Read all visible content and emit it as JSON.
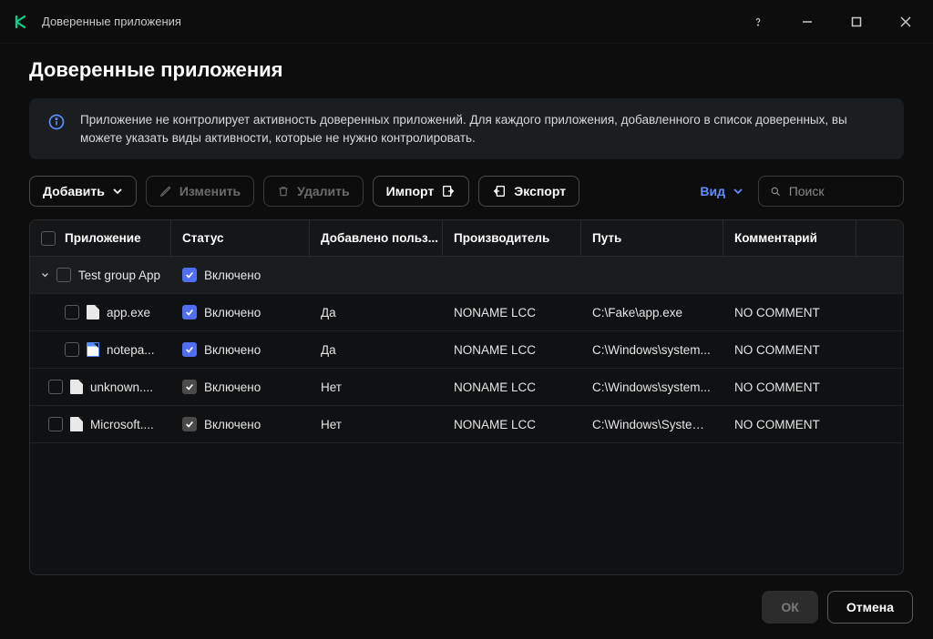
{
  "window": {
    "title": "Доверенные приложения"
  },
  "page": {
    "heading": "Доверенные приложения",
    "info": "Приложение не контролирует активность доверенных приложений. Для каждого приложения, добавленного в список доверенных, вы можете указать виды активности, которые не нужно контролировать."
  },
  "toolbar": {
    "add": "Добавить",
    "edit": "Изменить",
    "delete": "Удалить",
    "import": "Импорт",
    "export": "Экспорт",
    "view": "Вид"
  },
  "search": {
    "placeholder": "Поиск"
  },
  "columns": {
    "app": "Приложение",
    "status": "Статус",
    "added": "Добавлено польз...",
    "vendor": "Производитель",
    "path": "Путь",
    "comment": "Комментарий"
  },
  "group": {
    "name": "Test group App",
    "status": "Включено"
  },
  "rows": [
    {
      "name": "app.exe",
      "icon": "file",
      "status": "Включено",
      "status_style": "blue",
      "added": "Да",
      "vendor": "NONAME LCC",
      "path": "C:\\Fake\\app.exe",
      "comment": "NO COMMENT",
      "indent": 2
    },
    {
      "name": "notepa...",
      "icon": "notepad",
      "status": "Включено",
      "status_style": "blue",
      "added": "Да",
      "vendor": "NONAME LCC",
      "path": "C:\\Windows\\system...",
      "comment": "NO COMMENT",
      "indent": 2
    },
    {
      "name": "unknown....",
      "icon": "file",
      "status": "Включено",
      "status_style": "grey",
      "added": "Нет",
      "vendor": "NONAME LCC",
      "path": "C:\\Windows\\system...",
      "comment": "NO COMMENT",
      "indent": 1
    },
    {
      "name": "Microsoft....",
      "icon": "file",
      "status": "Включено",
      "status_style": "grey",
      "added": "Нет",
      "vendor": "NONAME LCC",
      "path": "C:\\Windows\\System...",
      "comment": "NO COMMENT",
      "indent": 1
    }
  ],
  "footer": {
    "ok": "ОК",
    "cancel": "Отмена"
  }
}
